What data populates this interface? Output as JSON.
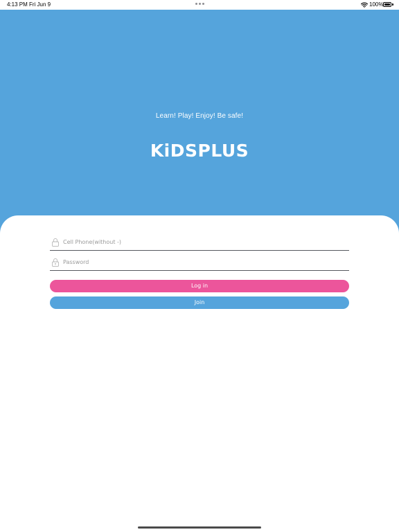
{
  "status_bar": {
    "time": "4:13 PM",
    "date": "Fri Jun 9",
    "battery": "100%"
  },
  "hero": {
    "tagline": "Learn! Play! Enjoy! Be safe!",
    "logo_text": "KiDSPLUS"
  },
  "login_form": {
    "phone_placeholder": "Cell Phone(without -)",
    "phone_value": "",
    "password_placeholder": "Password",
    "password_value": "",
    "field_icon": "lock-icon",
    "login_label": "Log in",
    "join_label": "Join"
  },
  "colors": {
    "hero_background": "#55a4dc",
    "login_button": "#ec559b",
    "join_button": "#55a4dc",
    "field_underline": "#55585e"
  }
}
